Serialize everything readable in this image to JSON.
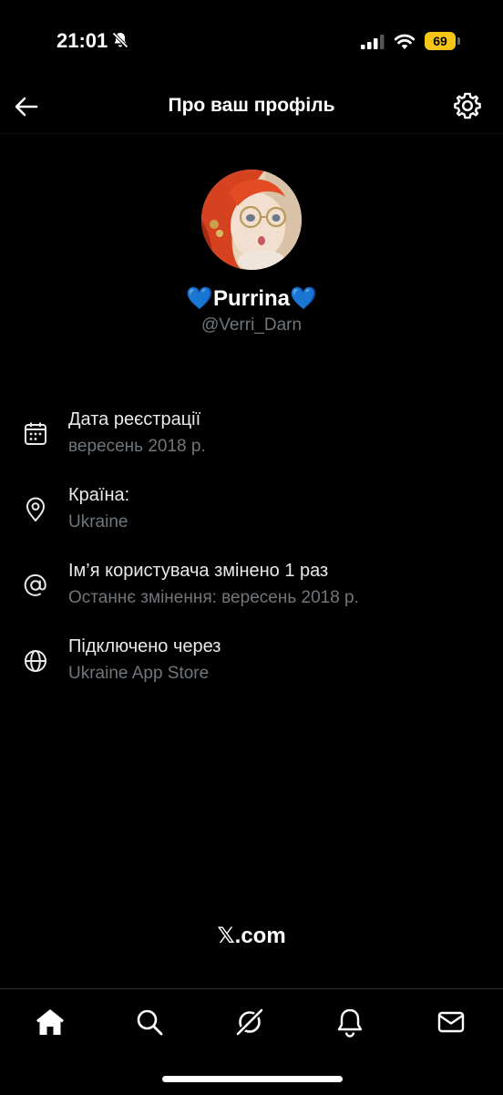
{
  "status_bar": {
    "time": "21:01",
    "battery": "69",
    "icons": [
      "bell-slash-icon",
      "cellular-signal-icon",
      "wifi-icon",
      "battery-icon"
    ]
  },
  "header": {
    "title": "Про ваш профіль",
    "back_icon": "arrow-left-icon",
    "settings_icon": "gear-icon"
  },
  "profile": {
    "display_name": "💙Purrina💙",
    "handle": "@Verri_Darn"
  },
  "details": [
    {
      "icon": "calendar-icon",
      "label": "Дата реєстрації",
      "value": "вересень 2018 р."
    },
    {
      "icon": "location-pin-icon",
      "label": "Країна:",
      "value": "Ukraine"
    },
    {
      "icon": "at-sign-icon",
      "label": "Ім’я користувача змінено 1 раз",
      "value": "Останнє змінення: вересень 2018 р."
    },
    {
      "icon": "globe-icon",
      "label": "Підключено через",
      "value": "Ukraine App Store"
    }
  ],
  "footer": {
    "brand": "𝕏.com"
  },
  "tab_bar": {
    "tabs": [
      "home-icon",
      "search-icon",
      "grok-icon",
      "bell-icon",
      "mail-icon"
    ]
  },
  "colors": {
    "background": "#000000",
    "primary_text": "#e7e9ea",
    "secondary_text": "#71767b",
    "battery": "#f5c518"
  }
}
